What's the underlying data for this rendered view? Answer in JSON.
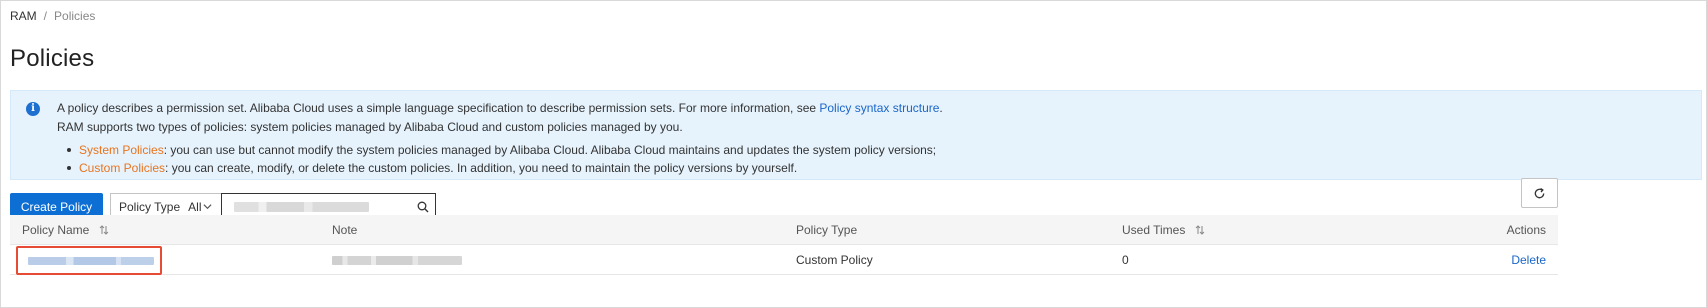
{
  "breadcrumb": {
    "root": "RAM",
    "separator": "/",
    "current": "Policies"
  },
  "page_title": "Policies",
  "notice": {
    "line1_text": "A policy describes a permission set. Alibaba Cloud uses a simple language specification to describe permission sets. For more information, see ",
    "line1_link": "Policy syntax structure",
    "line1_end": ".",
    "line2_text": "RAM supports two types of policies: system policies managed by Alibaba Cloud and custom policies managed by you.",
    "bullet1_label": "System Policies",
    "bullet1_text": ": you can use but cannot modify the system policies managed by Alibaba Cloud. Alibaba Cloud maintains and updates the system policy versions;",
    "bullet2_label": "Custom Policies",
    "bullet2_text": ": you can create, modify, or delete the custom policies. In addition, you need to maintain the policy versions by yourself."
  },
  "toolbar": {
    "create_label": "Create Policy",
    "type_label": "Policy Type",
    "type_value": "All",
    "search_value": ""
  },
  "table": {
    "headers": [
      "Policy Name",
      "Note",
      "Policy Type",
      "Used Times",
      "Actions"
    ],
    "rows": [
      {
        "policy_type": "Custom Policy",
        "used_times": "0",
        "action": "Delete"
      }
    ]
  },
  "icons": {
    "info": "info-icon",
    "chevron": "chevron-down-icon",
    "search": "search-icon",
    "refresh": "refresh-icon",
    "sort": "sort-icon"
  },
  "colors": {
    "primary": "#0d6fd4",
    "link": "#1a66c9",
    "highlight": "#e8741e",
    "notice_bg": "#e6f3fc",
    "callout_border": "#e54b35"
  }
}
